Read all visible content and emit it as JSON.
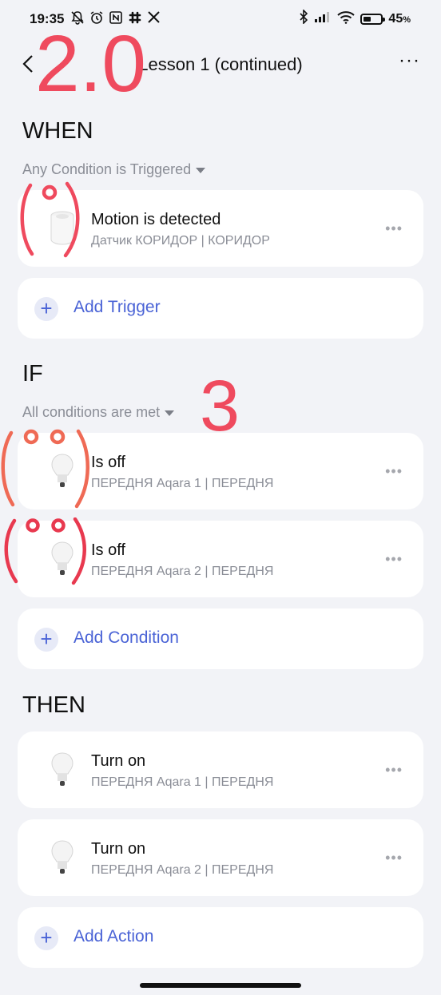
{
  "status_bar": {
    "time": "19:35",
    "battery_percent": "45",
    "battery_suffix": "%",
    "battery_level": 0.45,
    "left_icons": [
      "muted-bell-icon",
      "alarm-icon",
      "nfc-icon",
      "slack-icon",
      "x-icon"
    ],
    "right_icons": [
      "bluetooth-icon",
      "signal-icon",
      "wifi-icon",
      "battery-icon"
    ]
  },
  "header": {
    "title": "Lesson 1 (continued)",
    "more_label": "···"
  },
  "annotations": {
    "label_top": "2.0",
    "label_mid": "3",
    "color": "#ef4a5e"
  },
  "when": {
    "title": "WHEN",
    "mode": "Any Condition is Triggered",
    "items": [
      {
        "main": "Motion is detected",
        "sub": "Датчик КОРИДОР | КОРИДОР",
        "icon": "motion-sensor-icon"
      }
    ],
    "add_label": "Add Trigger"
  },
  "if": {
    "title": "IF",
    "mode": "All conditions are met",
    "items": [
      {
        "main": "Is off",
        "sub": "ПЕРЕДНЯ Aqara 1 | ПЕРЕДНЯ",
        "icon": "bulb-icon"
      },
      {
        "main": "Is off",
        "sub": "ПЕРЕДНЯ Aqara 2 | ПЕРЕДНЯ",
        "icon": "bulb-icon"
      }
    ],
    "add_label": "Add Condition"
  },
  "then": {
    "title": "THEN",
    "items": [
      {
        "main": "Turn on",
        "sub": "ПЕРЕДНЯ Aqara 1 | ПЕРЕДНЯ",
        "icon": "bulb-icon"
      },
      {
        "main": "Turn on",
        "sub": "ПЕРЕДНЯ Aqara 2 | ПЕРЕДНЯ",
        "icon": "bulb-icon"
      }
    ],
    "add_label": "Add Action"
  },
  "colors": {
    "accent": "#4a63d6",
    "background": "#f2f3f7",
    "card": "#ffffff",
    "secondary_text": "#8a8d96"
  }
}
